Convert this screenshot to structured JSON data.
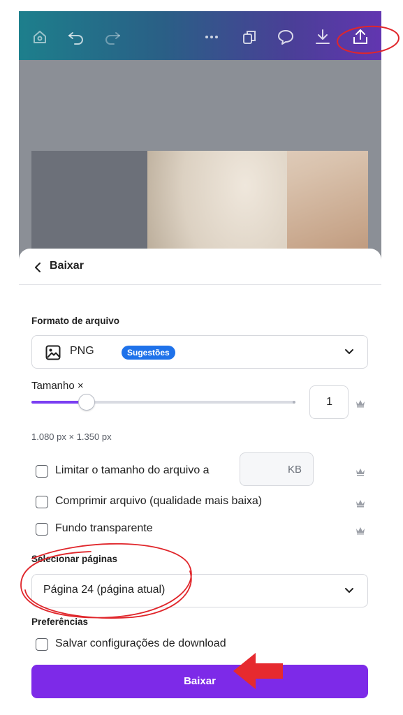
{
  "toolbar": {
    "icons": [
      "home-icon",
      "undo-icon",
      "redo-icon",
      "more-icon",
      "pages-icon",
      "comment-icon",
      "download-icon",
      "share-icon"
    ]
  },
  "download_panel": {
    "title": "Baixar",
    "file_format": {
      "label": "Formato de arquivo",
      "value": "PNG",
      "badge": "Sugestões"
    },
    "size": {
      "label": "Tamanho ×",
      "slider_value_fraction": 0.21,
      "multiplier": "1",
      "dimensions": "1.080 px × 1.350 px"
    },
    "options": [
      {
        "label": "Limitar o tamanho do arquivo a",
        "checked": false
      },
      {
        "label": "Comprimir arquivo (qualidade mais baixa)",
        "checked": false
      },
      {
        "label": "Fundo transparente",
        "checked": false
      }
    ],
    "file_size_unit": "KB",
    "select_pages": {
      "label": "Selecionar páginas",
      "value": "Página 24 (página atual)"
    },
    "preferences": {
      "label": "Preferências",
      "save_settings": "Salvar configurações de download"
    },
    "download_button": "Baixar"
  },
  "colors": {
    "accent": "#7d2ae8",
    "badge": "#1f72ea",
    "annotation": "#e0262b"
  }
}
